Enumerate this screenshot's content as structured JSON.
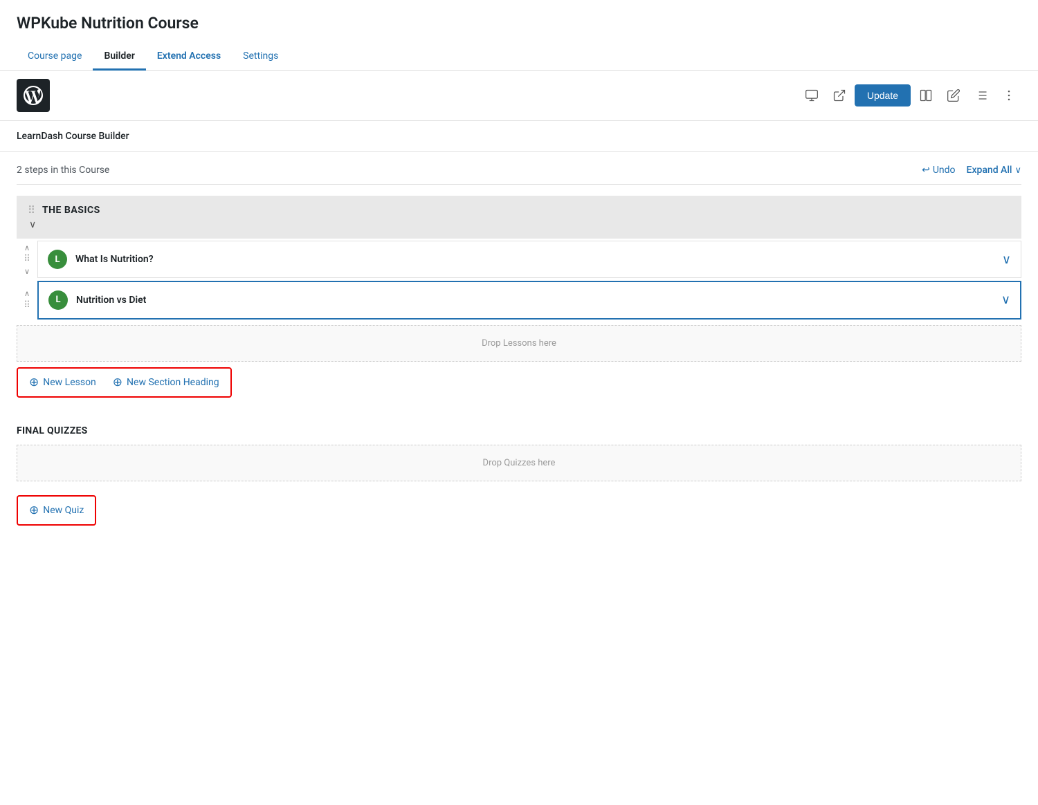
{
  "page": {
    "title": "WPKube Nutrition Course"
  },
  "tabs": [
    {
      "id": "course-page",
      "label": "Course page",
      "active": false,
      "highlight": false
    },
    {
      "id": "builder",
      "label": "Builder",
      "active": true,
      "highlight": false
    },
    {
      "id": "extend-access",
      "label": "Extend Access",
      "active": false,
      "highlight": true
    },
    {
      "id": "settings",
      "label": "Settings",
      "active": false,
      "highlight": false
    }
  ],
  "toolbar": {
    "update_label": "Update",
    "icons": {
      "desktop": "⬜",
      "external_link": "⧉",
      "split_view": "⬛",
      "edit": "✏",
      "list": "☰",
      "more": "⋮"
    }
  },
  "builder": {
    "section_heading": "LearnDash Course Builder",
    "steps_count": "2 steps in this Course",
    "undo_label": "Undo",
    "expand_label": "Expand All",
    "sections": [
      {
        "id": "the-basics",
        "title": "THE BASICS",
        "collapsed": true,
        "lessons": [
          {
            "id": "what-is-nutrition",
            "title": "What Is Nutrition?",
            "badge": "L",
            "selected": false
          },
          {
            "id": "nutrition-vs-diet",
            "title": "Nutrition vs Diet",
            "badge": "L",
            "selected": true
          }
        ]
      }
    ],
    "drop_lessons_text": "Drop Lessons here",
    "add_lesson_label": "New Lesson",
    "add_section_heading_label": "New Section Heading",
    "final_quizzes": {
      "title": "FINAL QUIZZES",
      "drop_text": "Drop Quizzes here",
      "add_quiz_label": "New Quiz"
    }
  }
}
